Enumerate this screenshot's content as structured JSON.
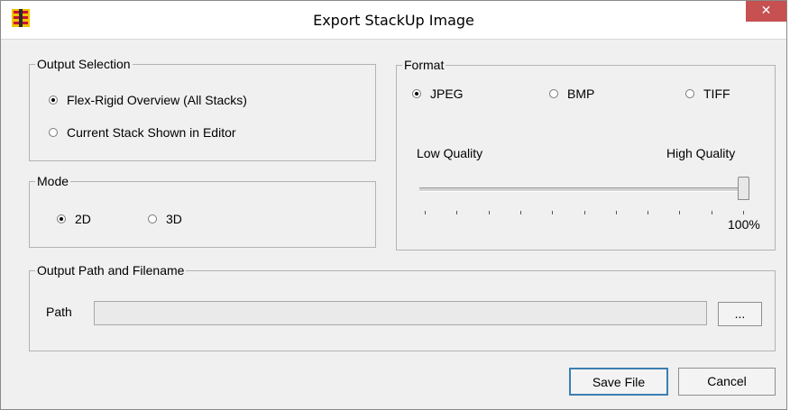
{
  "window": {
    "title": "Export StackUp Image",
    "close_label": "✕"
  },
  "output_selection": {
    "label": "Output Selection",
    "options": [
      {
        "label": "Flex-Rigid Overview (All Stacks)",
        "selected": true
      },
      {
        "label": "Current Stack Shown in Editor",
        "selected": false
      }
    ]
  },
  "mode": {
    "label": "Mode",
    "options": [
      {
        "label": "2D",
        "selected": true
      },
      {
        "label": "3D",
        "selected": false
      }
    ]
  },
  "format": {
    "label": "Format",
    "options": [
      {
        "label": "JPEG",
        "selected": true
      },
      {
        "label": "BMP",
        "selected": false
      },
      {
        "label": "TIFF",
        "selected": false
      }
    ],
    "quality": {
      "low_label": "Low Quality",
      "high_label": "High Quality",
      "value_label": "100%",
      "value_percent": 100
    }
  },
  "output_path": {
    "label": "Output Path and Filename",
    "path_label": "Path",
    "path_value": "",
    "browse_label": "..."
  },
  "buttons": {
    "save_label": "Save File",
    "cancel_label": "Cancel"
  }
}
